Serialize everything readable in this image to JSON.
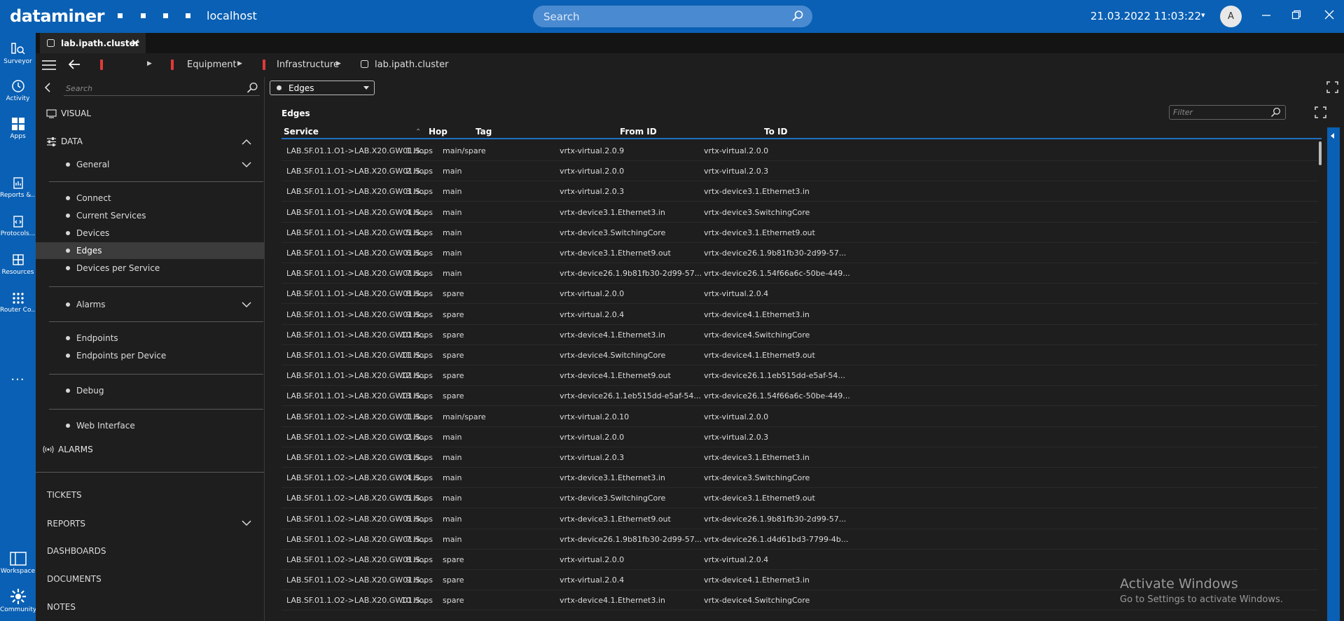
{
  "titlebar": {
    "app_name": "dataminer",
    "host": "localhost",
    "search_placeholder": "Search",
    "datetime": "21.03.2022 11:03:22",
    "user_initial": "A"
  },
  "rail": {
    "items": [
      {
        "label": "Surveyor",
        "icon": "surveyor-icon"
      },
      {
        "label": "Activity",
        "icon": "activity-icon"
      },
      {
        "label": "Apps",
        "icon": "apps-icon"
      },
      {
        "label": "Reports &...",
        "icon": "reports-icon"
      },
      {
        "label": "Protocols...",
        "icon": "protocols-icon"
      },
      {
        "label": "Resources",
        "icon": "resources-icon"
      },
      {
        "label": "Router Co...",
        "icon": "router-icon"
      }
    ],
    "more": "...",
    "bottom": [
      {
        "label": "Workspace",
        "icon": "workspace-icon"
      },
      {
        "label": "Community",
        "icon": "community-icon"
      }
    ]
  },
  "tab": {
    "label": "lab.ipath.cluster"
  },
  "breadcrumb": {
    "items": [
      "Equipment",
      "Infrastructure",
      "lab.ipath.cluster"
    ]
  },
  "sidebar": {
    "search_placeholder": "Search",
    "visual": "VISUAL",
    "data": "DATA",
    "groups": {
      "general": "General",
      "connect": "Connect",
      "current_services": "Current Services",
      "devices": "Devices",
      "edges": "Edges",
      "devices_per_service": "Devices per Service",
      "alarms": "Alarms",
      "endpoints": "Endpoints",
      "endpoints_per_device": "Endpoints per Device",
      "debug": "Debug",
      "web_interface": "Web Interface"
    },
    "alarms_section": "ALARMS",
    "tickets": "TICKETS",
    "reports": "REPORTS",
    "dashboards": "DASHBOARDS",
    "documents": "DOCUMENTS",
    "notes": "NOTES"
  },
  "content": {
    "dropdown_value": "Edges",
    "panel_title": "Edges",
    "filter_placeholder": "Filter",
    "columns": {
      "service": "Service",
      "hop": "Hop",
      "tag": "Tag",
      "from": "From ID",
      "to": "To ID"
    },
    "rows": [
      [
        "LAB.SF.01.1.O1->LAB.X20.GW01.S...",
        "1 Hops",
        "main/spare",
        "vrtx-virtual.2.0.9",
        "vrtx-virtual.2.0.0"
      ],
      [
        "LAB.SF.01.1.O1->LAB.X20.GW01.S...",
        "2 Hops",
        "main",
        "vrtx-virtual.2.0.0",
        "vrtx-virtual.2.0.3"
      ],
      [
        "LAB.SF.01.1.O1->LAB.X20.GW01.S...",
        "3 Hops",
        "main",
        "vrtx-virtual.2.0.3",
        "vrtx-device3.1.Ethernet3.in"
      ],
      [
        "LAB.SF.01.1.O1->LAB.X20.GW01.S...",
        "4 Hops",
        "main",
        "vrtx-device3.1.Ethernet3.in",
        "vrtx-device3.SwitchingCore"
      ],
      [
        "LAB.SF.01.1.O1->LAB.X20.GW01.S...",
        "5 Hops",
        "main",
        "vrtx-device3.SwitchingCore",
        "vrtx-device3.1.Ethernet9.out"
      ],
      [
        "LAB.SF.01.1.O1->LAB.X20.GW01.S...",
        "6 Hops",
        "main",
        "vrtx-device3.1.Ethernet9.out",
        "vrtx-device26.1.9b81fb30-2d99-57..."
      ],
      [
        "LAB.SF.01.1.O1->LAB.X20.GW01.S...",
        "7 Hops",
        "main",
        "vrtx-device26.1.9b81fb30-2d99-57...",
        "vrtx-device26.1.54f66a6c-50be-449..."
      ],
      [
        "LAB.SF.01.1.O1->LAB.X20.GW01.S...",
        "8 Hops",
        "spare",
        "vrtx-virtual.2.0.0",
        "vrtx-virtual.2.0.4"
      ],
      [
        "LAB.SF.01.1.O1->LAB.X20.GW01.S...",
        "9 Hops",
        "spare",
        "vrtx-virtual.2.0.4",
        "vrtx-device4.1.Ethernet3.in"
      ],
      [
        "LAB.SF.01.1.O1->LAB.X20.GW01.S...",
        "10 Hops",
        "spare",
        "vrtx-device4.1.Ethernet3.in",
        "vrtx-device4.SwitchingCore"
      ],
      [
        "LAB.SF.01.1.O1->LAB.X20.GW01.S...",
        "11 Hops",
        "spare",
        "vrtx-device4.SwitchingCore",
        "vrtx-device4.1.Ethernet9.out"
      ],
      [
        "LAB.SF.01.1.O1->LAB.X20.GW01.S...",
        "12 Hops",
        "spare",
        "vrtx-device4.1.Ethernet9.out",
        "vrtx-device26.1.1eb515dd-e5af-54..."
      ],
      [
        "LAB.SF.01.1.O1->LAB.X20.GW01.S...",
        "13 Hops",
        "spare",
        "vrtx-device26.1.1eb515dd-e5af-54...",
        "vrtx-device26.1.54f66a6c-50be-449..."
      ],
      [
        "LAB.SF.01.1.O2->LAB.X20.GW01.S...",
        "1 Hops",
        "main/spare",
        "vrtx-virtual.2.0.10",
        "vrtx-virtual.2.0.0"
      ],
      [
        "LAB.SF.01.1.O2->LAB.X20.GW01.S...",
        "2 Hops",
        "main",
        "vrtx-virtual.2.0.0",
        "vrtx-virtual.2.0.3"
      ],
      [
        "LAB.SF.01.1.O2->LAB.X20.GW01.S...",
        "3 Hops",
        "main",
        "vrtx-virtual.2.0.3",
        "vrtx-device3.1.Ethernet3.in"
      ],
      [
        "LAB.SF.01.1.O2->LAB.X20.GW01.S...",
        "4 Hops",
        "main",
        "vrtx-device3.1.Ethernet3.in",
        "vrtx-device3.SwitchingCore"
      ],
      [
        "LAB.SF.01.1.O2->LAB.X20.GW01.S...",
        "5 Hops",
        "main",
        "vrtx-device3.SwitchingCore",
        "vrtx-device3.1.Ethernet9.out"
      ],
      [
        "LAB.SF.01.1.O2->LAB.X20.GW01.S...",
        "6 Hops",
        "main",
        "vrtx-device3.1.Ethernet9.out",
        "vrtx-device26.1.9b81fb30-2d99-57..."
      ],
      [
        "LAB.SF.01.1.O2->LAB.X20.GW01.S...",
        "7 Hops",
        "main",
        "vrtx-device26.1.9b81fb30-2d99-57...",
        "vrtx-device26.1.d4d61bd3-7799-4b..."
      ],
      [
        "LAB.SF.01.1.O2->LAB.X20.GW01.S...",
        "8 Hops",
        "spare",
        "vrtx-virtual.2.0.0",
        "vrtx-virtual.2.0.4"
      ],
      [
        "LAB.SF.01.1.O2->LAB.X20.GW01.S...",
        "9 Hops",
        "spare",
        "vrtx-virtual.2.0.4",
        "vrtx-device4.1.Ethernet3.in"
      ],
      [
        "LAB.SF.01.1.O2->LAB.X20.GW01.S...",
        "10 Hops",
        "spare",
        "vrtx-device4.1.Ethernet3.in",
        "vrtx-device4.SwitchingCore"
      ]
    ]
  },
  "watermark": {
    "title": "Activate Windows",
    "subtitle": "Go to Settings to activate Windows."
  },
  "colors": {
    "brand": "#0a60b4",
    "background": "#1e1e1e",
    "selected": "#3c3c3c",
    "accent_red": "#e03a3a"
  }
}
